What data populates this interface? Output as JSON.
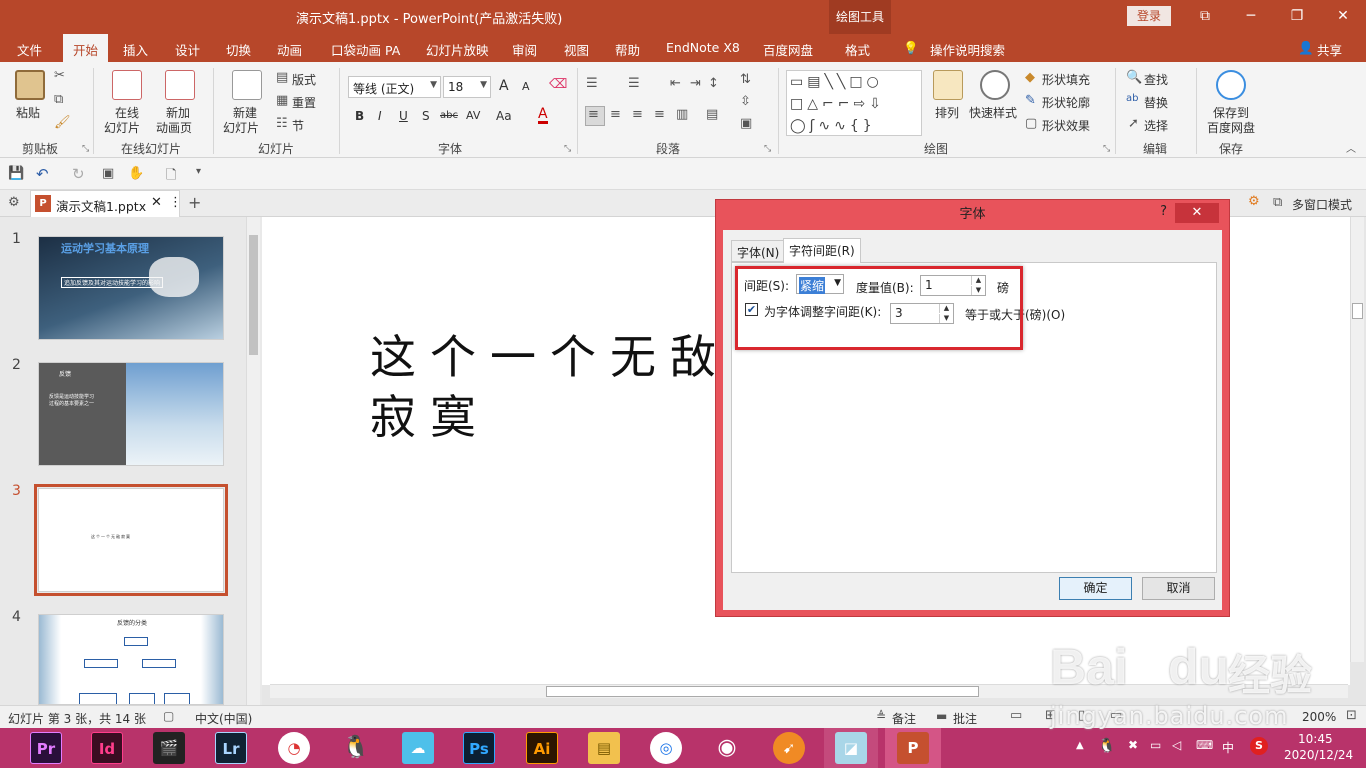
{
  "titlebar": {
    "title": "演示文稿1.pptx  -  PowerPoint(产品激活失败)",
    "context_tab": "绘图工具",
    "login": "登录",
    "restore_ribbon": "⧉",
    "minimize": "─",
    "maximize": "❐",
    "close": "✕"
  },
  "tabs": [
    "文件",
    "开始",
    "插入",
    "设计",
    "切换",
    "动画",
    "口袋动画 PA",
    "幻灯片放映",
    "审阅",
    "视图",
    "帮助",
    "EndNote X8",
    "百度网盘",
    "格式"
  ],
  "tell_me": "操作说明搜索",
  "share": "共享",
  "ribbon": {
    "clipboard": {
      "paste": "粘贴",
      "label": "剪贴板"
    },
    "online": {
      "online_slides": "在线",
      "online_slides2": "幻灯片",
      "new_anim": "新加",
      "new_anim2": "动画页",
      "label": "在线幻灯片"
    },
    "slides": {
      "new_slide": "新建",
      "new_slide2": "幻灯片",
      "layout": "版式",
      "reset": "重置",
      "section": "节",
      "label": "幻灯片"
    },
    "font": {
      "font_name": "等线 (正文)",
      "font_size": "18",
      "bold": "B",
      "italic": "I",
      "underline": "U",
      "shadow": "S",
      "strike": "abc",
      "spacing": "AV",
      "case": "Aa",
      "color": "A",
      "grow": "A",
      "shrink": "A",
      "label": "字体"
    },
    "paragraph": {
      "label": "段落"
    },
    "drawing": {
      "arrange": "排列",
      "quick_styles": "快速样式",
      "fill": "形状填充",
      "outline": "形状轮廓",
      "effects": "形状效果",
      "label": "绘图"
    },
    "editing": {
      "find": "查找",
      "replace": "替换",
      "select": "选择",
      "label": "编辑"
    },
    "save": {
      "save_to": "保存到",
      "baidu": "百度网盘",
      "label": "保存"
    }
  },
  "docstrip": {
    "tab_name": "演示文稿1.pptx",
    "multi_window": "多窗口模式"
  },
  "thumbnails": [
    {
      "num": "1",
      "title": "运动学习基本原理",
      "subtitle": "追加反馈及其对运动技能学习的影响"
    },
    {
      "num": "2",
      "title": "反馈",
      "line1": "反馈是运动技能学习",
      "line2": "过程的基本要素之一"
    },
    {
      "num": "3",
      "text": "这个一个无敌寂寞"
    },
    {
      "num": "4",
      "title": "反馈的分类"
    }
  ],
  "slide": {
    "line1": "这个一个无敌",
    "line2": "寂寞"
  },
  "dialog": {
    "title": "字体",
    "help": "?",
    "close": "✕",
    "tab_font": "字体(N)",
    "tab_spacing": "字符间距(R)",
    "spacing_label": "间距(S):",
    "spacing_value": "紧缩",
    "measure_label": "度量值(B):",
    "measure_value": "1",
    "unit": "磅",
    "kerning_label": "为字体调整字间距(K):",
    "kerning_value": "3",
    "kerning_suffix": "等于或大于(磅)(O)",
    "ok": "确定",
    "cancel": "取消"
  },
  "status": {
    "slide_info": "幻灯片 第 3 张，共 14 张",
    "language": "中文(中国)",
    "notes": "备注",
    "comments": "批注",
    "zoom": "200%"
  },
  "taskbar": {
    "apps": [
      "Pr",
      "Id",
      "",
      "Lr",
      "",
      "",
      "",
      "Ps",
      "Ai",
      "",
      "",
      "",
      "",
      "",
      "P"
    ],
    "time": "10:45",
    "date": "2020/12/24",
    "ime": "中"
  },
  "watermark": {
    "brand": "Bai",
    "brand2": "du",
    "cn": "经验",
    "url": "jingyan.baidu.com"
  },
  "colors": {
    "accent": "#b7472a",
    "dialog_frame": "#e8535b",
    "highlight_box": "#d9272e",
    "taskbar": "#b8336a"
  }
}
